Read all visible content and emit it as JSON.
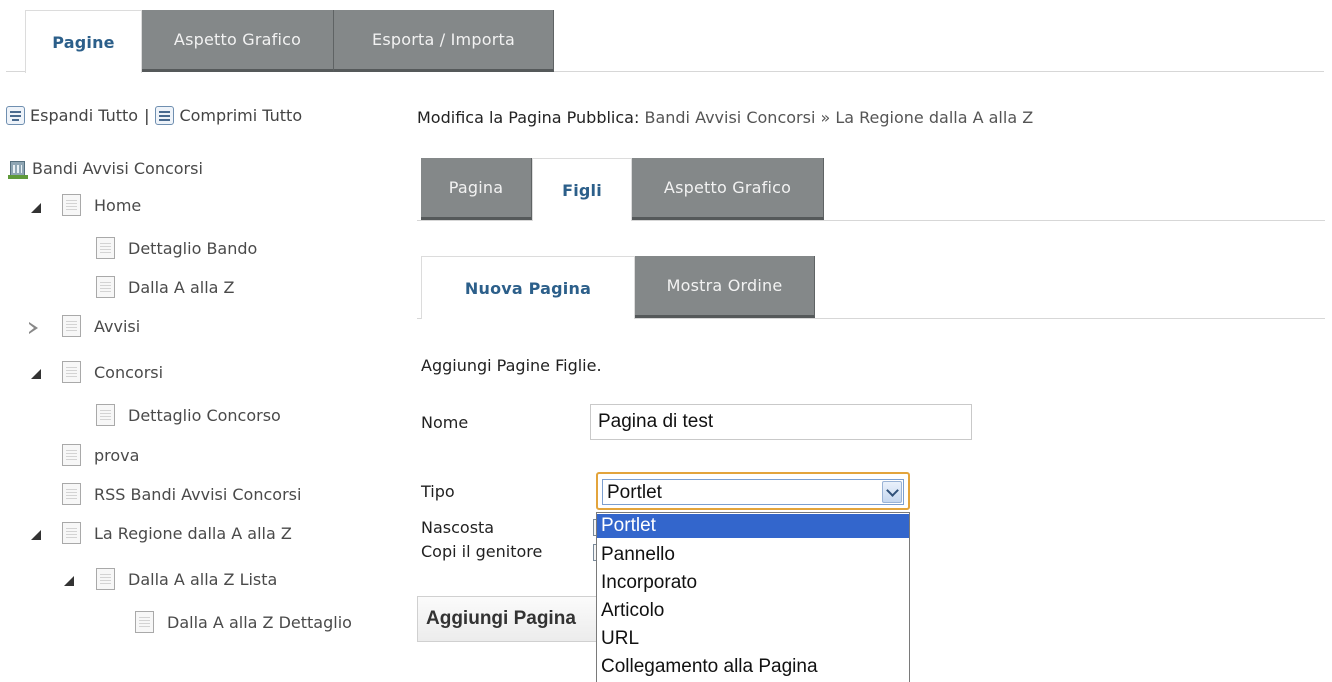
{
  "top_tabs": [
    {
      "label": "Pagine",
      "active": true
    },
    {
      "label": "Aspetto Grafico",
      "active": false
    },
    {
      "label": "Esporta / Importa",
      "active": false
    }
  ],
  "tree_toolbar": {
    "expand_label": "Espandi Tutto",
    "separator": "|",
    "collapse_label": "Comprimi Tutto"
  },
  "tree": {
    "root": "Bandi Avvisi Concorsi",
    "items": [
      "Home",
      "Dettaglio Bando",
      "Dalla A alla Z",
      "Avvisi",
      "Concorsi",
      "Dettaglio Concorso",
      "prova",
      "RSS Bandi Avvisi Concorsi",
      "La Regione dalla A alla Z",
      "Dalla A alla Z Lista",
      "Dalla A alla Z Dettaglio"
    ]
  },
  "editor": {
    "title_prefix": "Modifica la Pagina Pubblica:",
    "breadcrumb": "Bandi Avvisi Concorsi » La Regione dalla A alla Z",
    "page_tabs": [
      {
        "label": "Pagina",
        "active": false
      },
      {
        "label": "Figli",
        "active": true
      },
      {
        "label": "Aspetto Grafico",
        "active": false
      }
    ],
    "child_tabs": [
      {
        "label": "Nuova Pagina",
        "active": true
      },
      {
        "label": "Mostra Ordine",
        "active": false
      }
    ],
    "intro": "Aggiungi Pagine Figlie.",
    "labels": {
      "name": "Nome",
      "type": "Tipo",
      "hidden": "Nascosta",
      "copy_parent": "Copi il genitore"
    },
    "name_value": "Pagina di test",
    "type_value": "Portlet",
    "type_options": [
      "Portlet",
      "Pannello",
      "Incorporato",
      "Articolo",
      "URL",
      "Collegamento alla Pagina"
    ],
    "selected_option": "Portlet",
    "submit_label": "Aggiungi Pagina"
  },
  "colors": {
    "active_tab_text": "#2c5f8a",
    "inactive_tab_bg": "#848889",
    "select_focus": "#e3a43c",
    "option_highlight": "#3366cc"
  }
}
